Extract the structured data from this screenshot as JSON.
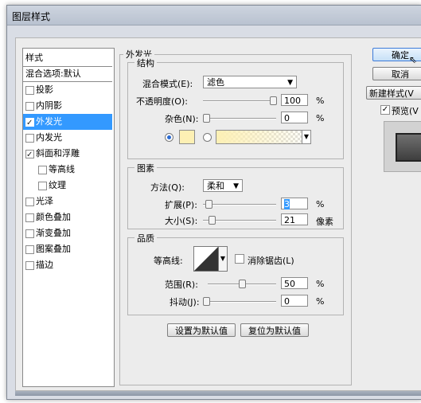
{
  "window": {
    "title": "图层样式"
  },
  "styles_list": {
    "header": "样式",
    "items": [
      {
        "label": "混合选项:默认",
        "checkbox": false,
        "checked": false,
        "selected": false,
        "indent": 0
      },
      {
        "label": "投影",
        "checkbox": true,
        "checked": false,
        "selected": false,
        "indent": 0
      },
      {
        "label": "内阴影",
        "checkbox": true,
        "checked": false,
        "selected": false,
        "indent": 0
      },
      {
        "label": "外发光",
        "checkbox": true,
        "checked": true,
        "selected": true,
        "indent": 0
      },
      {
        "label": "内发光",
        "checkbox": true,
        "checked": false,
        "selected": false,
        "indent": 0
      },
      {
        "label": "斜面和浮雕",
        "checkbox": true,
        "checked": true,
        "selected": false,
        "indent": 0
      },
      {
        "label": "等高线",
        "checkbox": true,
        "checked": false,
        "selected": false,
        "indent": 1
      },
      {
        "label": "纹理",
        "checkbox": true,
        "checked": false,
        "selected": false,
        "indent": 1
      },
      {
        "label": "光泽",
        "checkbox": true,
        "checked": false,
        "selected": false,
        "indent": 0
      },
      {
        "label": "颜色叠加",
        "checkbox": true,
        "checked": false,
        "selected": false,
        "indent": 0
      },
      {
        "label": "渐变叠加",
        "checkbox": true,
        "checked": false,
        "selected": false,
        "indent": 0
      },
      {
        "label": "图案叠加",
        "checkbox": true,
        "checked": false,
        "selected": false,
        "indent": 0
      },
      {
        "label": "描边",
        "checkbox": true,
        "checked": false,
        "selected": false,
        "indent": 0
      }
    ]
  },
  "outer_glow": {
    "title": "外发光",
    "structure": {
      "title": "结构",
      "blend_mode_label": "混合模式(E):",
      "blend_mode_value": "滤色",
      "opacity_label": "不透明度(O):",
      "opacity_value": "100",
      "opacity_unit": "%",
      "opacity_level": 1.0,
      "noise_label": "杂色(N):",
      "noise_value": "0",
      "noise_unit": "%",
      "noise_level": 0.0,
      "color_swatch": "#fdf0b4"
    },
    "elements": {
      "title": "图素",
      "technique_label": "方法(Q):",
      "technique_value": "柔和",
      "spread_label": "扩展(P):",
      "spread_value": "3",
      "spread_unit": "%",
      "spread_level": 0.03,
      "size_label": "大小(S):",
      "size_value": "21",
      "size_unit": "像素",
      "size_level": 0.084
    },
    "quality": {
      "title": "品质",
      "contour_label": "等高线:",
      "antialias_label": "消除锯齿(L)",
      "antialias_checked": false,
      "range_label": "范围(R):",
      "range_value": "50",
      "range_unit": "%",
      "range_level": 0.5,
      "jitter_label": "抖动(J):",
      "jitter_value": "0",
      "jitter_unit": "%",
      "jitter_level": 0.0
    },
    "make_default_label": "设置为默认值",
    "reset_default_label": "复位为默认值"
  },
  "right_panel": {
    "ok_label": "确定",
    "cancel_label": "取消",
    "new_style_label": "新建样式(V",
    "preview_label": "预览(V",
    "preview_checked": true
  },
  "colors": {
    "selection": "#3399ff",
    "swatch": "#fdf0b4",
    "default_button": "#3d7bd9"
  }
}
